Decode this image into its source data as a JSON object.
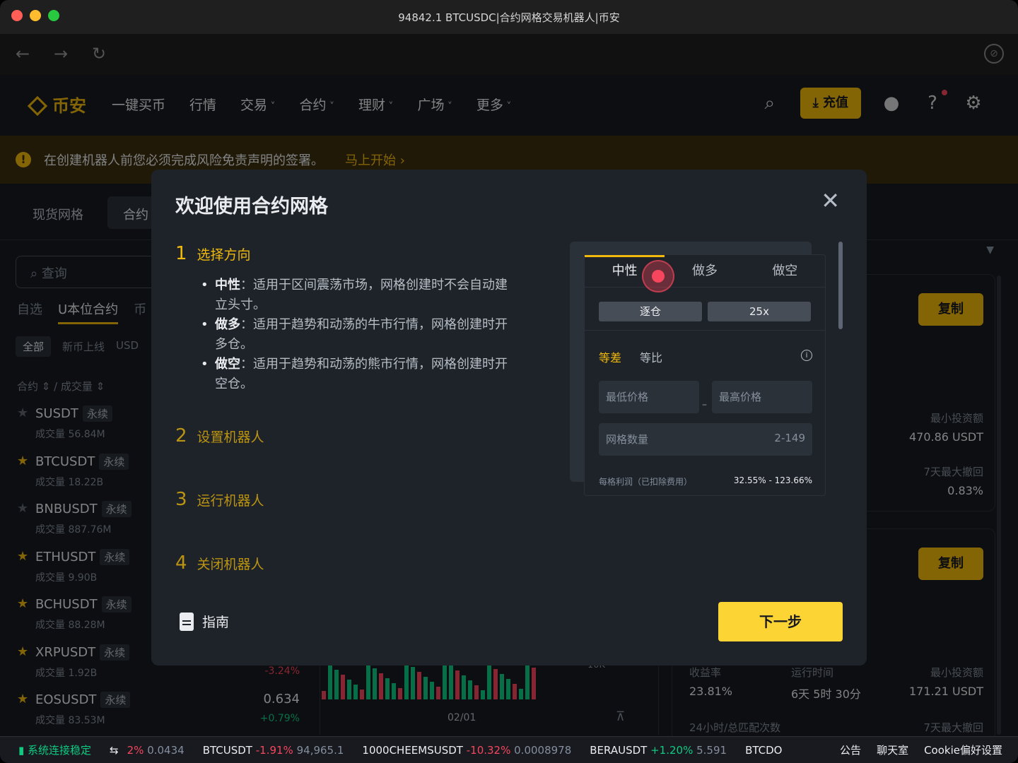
{
  "window": {
    "title": "94842.1 BTCUSDC|合约网格交易机器人|币安"
  },
  "header": {
    "logo_text": "币安",
    "nav": [
      "一键买币",
      "行情",
      "交易",
      "合约",
      "理财",
      "广场",
      "更多"
    ],
    "deposit_label": "充值"
  },
  "warning": {
    "text": "在创建机器人前您必须完成风险免责声明的签署。",
    "link": "马上开始 ›"
  },
  "bg": {
    "tab_spot": "现货网格",
    "tab_futures": "合约",
    "search_placeholder": "查询",
    "market_tabs": [
      "自选",
      "U本位合约",
      "币"
    ],
    "filters": [
      "全部",
      "新币上线",
      "USD"
    ],
    "col_header": "合约 ⇕ / 成交量 ⇕",
    "pairs": [
      {
        "name": "SUSDT",
        "badge": "永续",
        "vol": "成交量 56.84M",
        "price": "",
        "chg": ""
      },
      {
        "name": "BTCUSDT",
        "badge": "永续",
        "vol": "成交量 18.22B",
        "price": "",
        "chg": ""
      },
      {
        "name": "BNBUSDT",
        "badge": "永续",
        "vol": "成交量 887.76M",
        "price": "",
        "chg": ""
      },
      {
        "name": "ETHUSDT",
        "badge": "永续",
        "vol": "成交量 9.90B",
        "price": "",
        "chg": ""
      },
      {
        "name": "BCHUSDT",
        "badge": "永续",
        "vol": "成交量 88.28M",
        "price": "",
        "chg": ""
      },
      {
        "name": "XRPUSDT",
        "badge": "永续",
        "vol": "成交量 1.92B",
        "price": "",
        "chg": "-3.24%"
      },
      {
        "name": "EOSUSDT",
        "badge": "永续",
        "vol": "成交量 83.53M",
        "price": "0.634",
        "chg": "+0.79%"
      }
    ],
    "chart_date": "02/01",
    "chart_ylabel": "10K",
    "cards": [
      {
        "copy": "复制",
        "min_invest_label": "最小投资额",
        "min_invest": "470.86 USDT",
        "drawdown_label": "7天最大撤回",
        "drawdown": "0.83%"
      },
      {
        "copy": "复制",
        "roi_label": "收益率",
        "roi": "23.81%",
        "runtime_label": "运行时间",
        "runtime": "6天 5时 30分",
        "min_invest_label": "最小投资额",
        "min_invest": "171.21 USDT",
        "match_label": "24小时/总匹配次数",
        "drawdown_label": "7天最大撤回"
      }
    ]
  },
  "modal": {
    "title": "欢迎使用合约网格",
    "steps": [
      {
        "num": "1",
        "label": "选择方向"
      },
      {
        "num": "2",
        "label": "设置机器人"
      },
      {
        "num": "3",
        "label": "运行机器人"
      },
      {
        "num": "4",
        "label": "关闭机器人"
      }
    ],
    "desc": [
      {
        "term": "中性",
        "text": "：适用于区间震荡市场，网格创建时不会自动建立头寸。"
      },
      {
        "term": "做多",
        "text": "：适用于趋势和动荡的牛市行情，网格创建时开多仓。"
      },
      {
        "term": "做空",
        "text": "：适用于趋势和动荡的熊市行情，网格创建时开空仓。"
      }
    ],
    "guide_label": "指南",
    "next_label": "下一步",
    "preview": {
      "tabs": [
        "中性",
        "做多",
        "做空"
      ],
      "margin_mode": "逐仓",
      "leverage": "25x",
      "modes": [
        "等差",
        "等比"
      ],
      "min_price_placeholder": "最低价格",
      "max_price_placeholder": "最高价格",
      "grid_count_placeholder": "网格数量",
      "grid_count_range": "2-149",
      "profit_label": "每格利润（已扣除费用）",
      "profit_value": "32.55% - 123.66%"
    }
  },
  "statusbar": {
    "connection": "系统连接稳定",
    "tickers": [
      {
        "pre": "2%",
        "pre_color": "neg",
        "value": "0.0434"
      },
      {
        "symbol": "BTCUSDT",
        "change": "-1.91%",
        "price": "94,965.1"
      },
      {
        "symbol": "1000CHEEMSUSDT",
        "change": "-10.32%",
        "price": "0.0008978"
      },
      {
        "symbol": "BERAUSDT",
        "change": "+1.20%",
        "price": "5.591"
      },
      {
        "symbol": "BTCDO",
        "change": "",
        "price": ""
      }
    ],
    "right": [
      "公告",
      "聊天室",
      "Cookie偏好设置"
    ]
  }
}
